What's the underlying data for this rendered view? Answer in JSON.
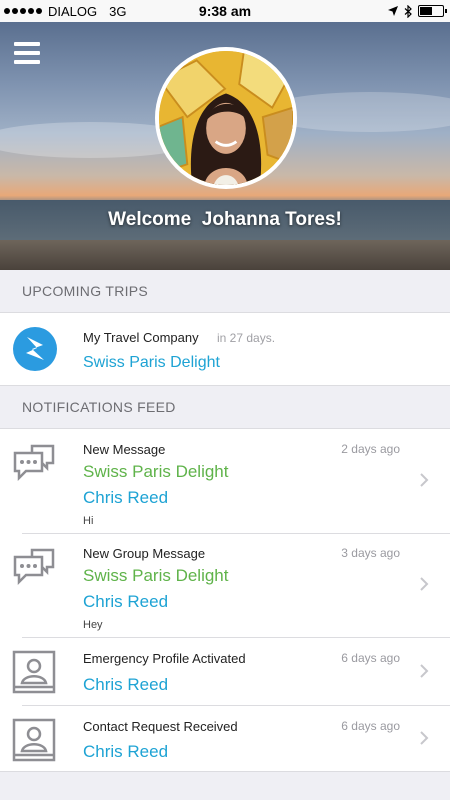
{
  "status_bar": {
    "carrier": "DIALOG",
    "network": "3G",
    "time": "9:38 am",
    "battery_level": 0.5
  },
  "header": {
    "welcome": "Welcome  Johanna Tores!"
  },
  "upcoming_trips": {
    "header": "UPCOMING TRIPS",
    "items": [
      {
        "company": "My Travel Company",
        "days": "in 27 days.",
        "trip": "Swiss Paris Delight"
      }
    ]
  },
  "notifications": {
    "header": "NOTIFICATIONS FEED",
    "items": [
      {
        "title": "New Message",
        "time": "2 days ago",
        "trip": "Swiss Paris Delight",
        "person": "Chris Reed",
        "message": "Hi",
        "icon": "chat-icon"
      },
      {
        "title": "New Group Message",
        "time": "3 days ago",
        "trip": "Swiss Paris Delight",
        "person": "Chris Reed",
        "message": "Hey",
        "icon": "chat-icon"
      },
      {
        "title": "Emergency Profile Activated",
        "time": "6 days ago",
        "person": "Chris Reed",
        "icon": "contact-card-icon"
      },
      {
        "title": "Contact Request Received",
        "time": "6 days ago",
        "person": "Chris Reed",
        "icon": "contact-card-icon"
      }
    ]
  },
  "colors": {
    "accent_blue": "#1ea3d4",
    "accent_green": "#5fb34a",
    "background": "#efeff4"
  }
}
